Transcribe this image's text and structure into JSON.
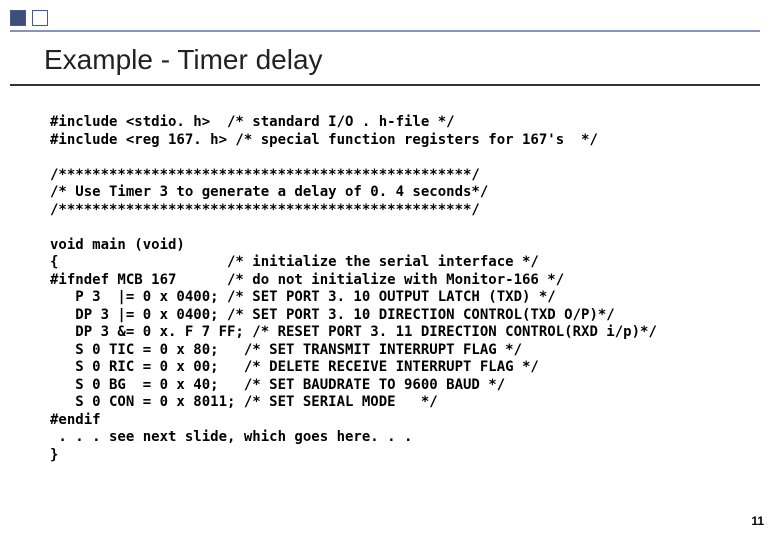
{
  "slide": {
    "title": "Example - Timer delay",
    "page_number": "11"
  },
  "code": {
    "inc1": "#include <stdio. h>  /* standard I/O . h-file */",
    "inc2": "#include <reg 167. h> /* special function registers for 167's  */",
    "sep1": "/*************************************************/",
    "cmt1": "/* Use Timer 3 to generate a delay of 0. 4 seconds*/",
    "sep2": "/*************************************************/",
    "l1": "void main (void)",
    "l2": "{                    /* initialize the serial interface */",
    "l3": "#ifndef MCB 167      /* do not initialize with Monitor-166 */",
    "l4": "   P 3  |= 0 x 0400; /* SET PORT 3. 10 OUTPUT LATCH (TXD) */",
    "l5": "   DP 3 |= 0 x 0400; /* SET PORT 3. 10 DIRECTION CONTROL(TXD O/P)*/",
    "l6": "   DP 3 &= 0 x. F 7 FF; /* RESET PORT 3. 11 DIRECTION CONTROL(RXD i/p)*/",
    "l7": "   S 0 TIC = 0 x 80;   /* SET TRANSMIT INTERRUPT FLAG */",
    "l8": "   S 0 RIC = 0 x 00;   /* DELETE RECEIVE INTERRUPT FLAG */",
    "l9": "   S 0 BG  = 0 x 40;   /* SET BAUDRATE TO 9600 BAUD */",
    "l10": "   S 0 CON = 0 x 8011; /* SET SERIAL MODE   */",
    "l11": "#endif",
    "l12": " . . . see next slide, which goes here. . .",
    "l13": "}"
  }
}
